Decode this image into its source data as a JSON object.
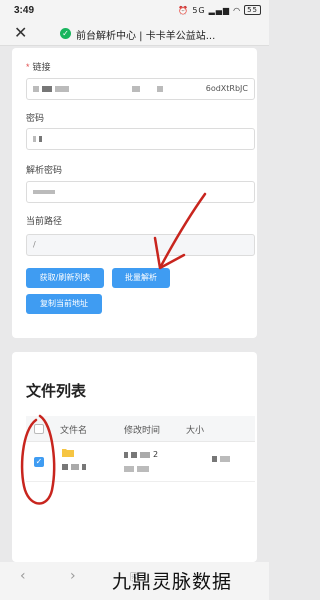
{
  "status_bar": {
    "time": "3:49",
    "icons": [
      "alarm-icon",
      "5g-icon",
      "signal-icon",
      "wifi-icon"
    ],
    "battery": "55"
  },
  "browser": {
    "page_title": "前台解析中心 | 卡卡羊公益站...",
    "shield_glyph": "✓"
  },
  "form": {
    "link_label": "链接",
    "link_value_tail": "6odXtRbJC",
    "password_label": "密码",
    "password_value": "",
    "parse_password_label": "解析密码",
    "parse_password_value": "",
    "current_path_label": "当前路径",
    "current_path_value": "/",
    "buttons": {
      "fetch_refresh": "获取/刷新列表",
      "batch_parse": "批量解析",
      "copy_address": "复制当前地址"
    }
  },
  "file_list": {
    "heading": "文件列表",
    "columns": [
      "文件名",
      "修改时间",
      "大小"
    ],
    "rows": [
      {
        "checked": true,
        "name": "",
        "modified": "2",
        "size": ""
      }
    ]
  },
  "annotation": {
    "stroke_color": "#c8251e"
  },
  "watermark": "九鼎灵脉数据",
  "colors": {
    "accent": "#3f9cf2",
    "required": "#e14c4c",
    "secure": "#19b55e"
  }
}
